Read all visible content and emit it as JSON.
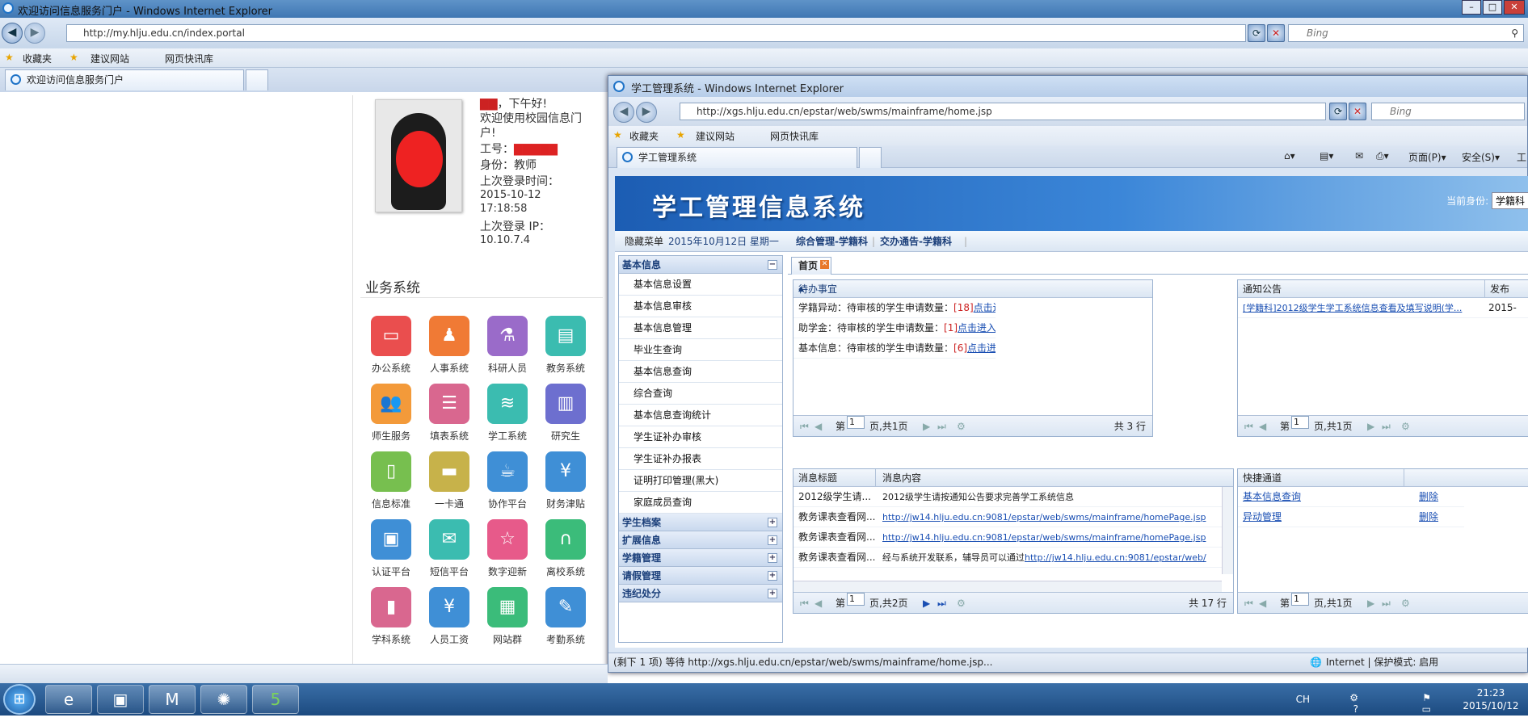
{
  "bg_window": {
    "title": "欢迎访问信息服务门户 - Windows Internet Explorer",
    "address": "http://my.hlju.edu.cn/index.portal",
    "search_placeholder": "Bing",
    "favorites": "收藏夹",
    "suggested_sites": "建议网站",
    "web_slice": "网页快讯库",
    "tab_label": "欢迎访问信息服务门户"
  },
  "portal": {
    "greeting": "，下午好!",
    "welcome": "欢迎使用校园信息门户!",
    "job_no_label": "工号：",
    "identity_label": "身份：",
    "identity_value": "教师",
    "last_login_time_label": "上次登录时间：",
    "last_login_date": "2015-10-12",
    "last_login_clock": "17:18:58",
    "last_login_ip_label": "上次登录 IP：",
    "last_login_ip": "10.10.7.4",
    "section_title": "业务系统",
    "apps": [
      {
        "label": "办公系统",
        "color": "#ea4e4e",
        "icon": "monitor-icon"
      },
      {
        "label": "人事系统",
        "color": "#f07a35",
        "icon": "person-icon"
      },
      {
        "label": "科研人员",
        "color": "#9a6bc9",
        "icon": "flask-icon"
      },
      {
        "label": "教务系统",
        "color": "#3bbcb0",
        "icon": "book-icon"
      },
      {
        "label": "师生服务",
        "color": "#f39a3a",
        "icon": "people-icon"
      },
      {
        "label": "填表系统",
        "color": "#d9678f",
        "icon": "form-icon"
      },
      {
        "label": "学工系统",
        "color": "#3bbcb0",
        "icon": "stack-icon"
      },
      {
        "label": "研究生",
        "color": "#6d6fcf",
        "icon": "books-icon"
      },
      {
        "label": "信息标准",
        "color": "#77bf4f",
        "icon": "notebook-icon"
      },
      {
        "label": "一卡通",
        "color": "#c7b24a",
        "icon": "card-icon"
      },
      {
        "label": "协作平台",
        "color": "#3f8fd6",
        "icon": "cup-icon"
      },
      {
        "label": "财务津贴",
        "color": "#3f8fd6",
        "icon": "yen-icon"
      },
      {
        "label": "认证平台",
        "color": "#3f8fd6",
        "icon": "screen-icon"
      },
      {
        "label": "短信平台",
        "color": "#3bbcb0",
        "icon": "mail-icon"
      },
      {
        "label": "数字迎新",
        "color": "#e75a8a",
        "icon": "runner-icon"
      },
      {
        "label": "离校系统",
        "color": "#3bbc7a",
        "icon": "arch-icon"
      },
      {
        "label": "学科系统",
        "color": "#d9678f",
        "icon": "doc-icon"
      },
      {
        "label": "人员工资",
        "color": "#3f8fd6",
        "icon": "yen-icon"
      },
      {
        "label": "网站群",
        "color": "#3bbc7a",
        "icon": "chip-icon"
      },
      {
        "label": "考勤系统",
        "color": "#3f8fd6",
        "icon": "clipboard-icon"
      }
    ]
  },
  "fg_window": {
    "title": "学工管理系统 - Windows Internet Explorer",
    "address": "http://xgs.hlju.edu.cn/epstar/web/swms/mainframe/home.jsp",
    "search_placeholder": "Bing",
    "favorites": "收藏夹",
    "suggested_sites": "建议网站",
    "web_slice": "网页快讯库",
    "tab_label": "学工管理系统",
    "cmd_page": "页面(P)",
    "cmd_safety": "安全(S)",
    "cmd_tools": "工"
  },
  "app": {
    "banner_title": "学工管理信息系统",
    "current_identity_label": "当前身份:",
    "current_identity_value": "学籍科",
    "hide_menu": "隐藏菜单",
    "date": "2015年10月12日 星期一",
    "menu_link_1": "综合管理-学籍科",
    "menu_link_2": "交办通告-学籍科",
    "home_tab": "首页",
    "sidebar": {
      "group_basic": "基本信息",
      "items": [
        "基本信息设置",
        "基本信息审核",
        "基本信息管理",
        "毕业生查询",
        "基本信息查询",
        "综合查询",
        "基本信息查询统计",
        "学生证补办审核",
        "学生证补办报表",
        "证明打印管理(黑大)",
        "家庭成员查询"
      ],
      "groups": [
        "学生档案",
        "扩展信息",
        "学籍管理",
        "请假管理",
        "违纪处分"
      ]
    },
    "todo": {
      "header": "待办事宜",
      "rows": [
        {
          "text": "学籍异动：待审核的学生申请数量：",
          "count": "[18]",
          "link": "点击进入"
        },
        {
          "text": "助学金：待审核的学生申请数量：",
          "count": "[1]",
          "link": "点击进入"
        },
        {
          "text": "基本信息：待审核的学生申请数量：",
          "count": "[6]",
          "link": "点击进入"
        }
      ],
      "pager_page_label": "第",
      "pager_page_value": "1",
      "pager_total": "页,共1页",
      "total": "共 3 行"
    },
    "notice": {
      "header": "通知公告",
      "header_col2": "发布",
      "row_title": "[学籍科]2012级学生学工系统信息查看及填写说明(学...",
      "row_date": "2015-",
      "pager_page_label": "第",
      "pager_page_value": "1",
      "pager_total": "页,共1页"
    },
    "messages": {
      "col_title": "消息标题",
      "col_content": "消息内容",
      "rows": [
        {
          "title": "2012级学生请...",
          "content": "2012级学生请按通知公告要求完善学工系统信息",
          "is_link": false
        },
        {
          "title": "教务课表查看网...",
          "content": "http://jw14.hlju.edu.cn:9081/epstar/web/swms/mainframe/homePage.jsp",
          "is_link": true
        },
        {
          "title": "教务课表查看网...",
          "content": "http://jw14.hlju.edu.cn:9081/epstar/web/swms/mainframe/homePage.jsp",
          "is_link": true
        },
        {
          "title": "教务课表查看网...",
          "content": "经与系统开发联系，辅导员可以通过",
          "extra": "http://jw14.hlju.edu.cn:9081/epstar/web/",
          "is_link": false
        }
      ],
      "pager_page_label": "第",
      "pager_page_value": "1",
      "pager_total": "页,共2页",
      "total": "共 17 行"
    },
    "quick": {
      "header": "快捷通道",
      "rows": [
        {
          "name": "基本信息查询",
          "action": "删除"
        },
        {
          "name": "异动管理",
          "action": "删除"
        }
      ],
      "pager_page_label": "第",
      "pager_page_value": "1",
      "pager_total": "页,共1页"
    }
  },
  "fg_status": {
    "text": "(剩下 1 项) 等待 http://xgs.hlju.edu.cn/epstar/web/swms/mainframe/home.jsp...",
    "zone": "Internet | 保护模式: 启用"
  },
  "taskbar": {
    "lang": "CH",
    "time": "21:23",
    "date": "2015/10/12"
  }
}
